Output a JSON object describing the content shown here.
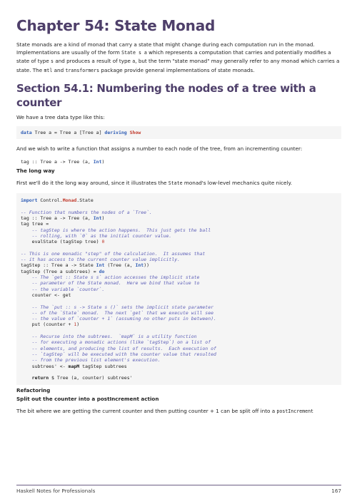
{
  "chapter_title": "Chapter 54: State Monad",
  "intro": {
    "p1": "State monads are a kind of monad that carry a state that might change during each computation run in the monad. Implementations are usually of the form ",
    "code1": "State s a",
    "p2": " which represents a computation that carries and potentially modifies a state of type ",
    "code2": "s",
    "p3": " and produces a result of type ",
    "code3": "a",
    "p4": ", but the term \"state monad\" may generally refer to any monad which carries a state. The ",
    "code4": "mtl",
    "p5": " and ",
    "code5": "transformers",
    "p6": " package provide general implementations of state monads."
  },
  "section_title": "Section 54.1: Numbering the nodes of a tree with a counter",
  "tree_intro": "We have a tree data type like this:",
  "tree_code": {
    "kw": "data",
    "body": " Tree a = Tree a [Tree a] ",
    "deriving": "deriving",
    "show": "Show"
  },
  "wish_text": "And we wish to write a function that assigns a number to each node of the tree, from an incrementing counter:",
  "tag_sig": {
    "pre": "tag :: Tree a -> Tree (a, ",
    "int": "Int",
    "post": ")"
  },
  "long_way_heading": "The long way",
  "long_way_text": {
    "pre": "First we'll do it the long way around, since it illustrates the ",
    "code": "State",
    "post": " monad's low-level mechanics quite nicely."
  },
  "code_block": {
    "import_kw": "import",
    "import_pre": " Control.",
    "import_monad": "Monad",
    "import_post": ".State",
    "lines": {
      "c1": "-- Function that numbers the nodes of a `Tree`.",
      "l2pre": "tag :: Tree a -> Tree (a, ",
      "l2int": "Int",
      "l2post": ")",
      "l3": "tag tree =",
      "c4": "    -- tagStep is where the action happens.  This just gets the ball",
      "c5": "    -- rolling, with `0` as the initial counter value.",
      "l6pre": "    evalState (tagStep tree) ",
      "l6num": "0",
      "c8": "-- This is one monadic \"step\" of the calculation.  It assumes that",
      "c9": "-- it has access to the current counter value implicitly.",
      "l10pre": "tagStep :: Tree a -> State ",
      "l10int1": "Int",
      "l10mid": " (Tree (a, ",
      "l10int2": "Int",
      "l10post": "))",
      "l11pre": "tagStep (Tree a subtrees) = ",
      "l11do": "do",
      "c12": "    -- The `get :: State s s` action accesses the implicit state",
      "c13": "    -- parameter of the State monad.  Here we bind that value to",
      "c14": "    -- the variable `counter`.",
      "l15": "    counter <- get",
      "c17": "    -- The `put :: s -> State s ()` sets the implicit state parameter",
      "c18": "    -- of the `State` monad.  The next `get` that we execute will see",
      "c19": "    -- the value of `counter + 1` (assuming no other puts in between).",
      "l20pre": "    put (counter + ",
      "l20num": "1",
      "l20post": ")",
      "c22": "    -- Recurse into the subtrees.  `mapM` is a utility function",
      "c23": "    -- for executing a monadic actions (like `tagStep`) on a list of",
      "c24": "    -- elements, and producing the list of results.  Each execution of",
      "c25": "    -- `tagStep` will be executed with the counter value that resulted",
      "c26": "    -- from the previous list element's execution.",
      "l27pre": "    subtrees' <- ",
      "l27mapm": "mapM",
      "l27post": " tagStep subtrees",
      "l29ret": "return",
      "l29post": " $ Tree (a, counter) subtrees'"
    }
  },
  "refactoring_heading": "Refactoring",
  "split_heading": "Split out the counter into a postIncrement action",
  "bottom_text": {
    "pre": "The bit where we are ",
    "get": "get",
    "mid1": "ting the current counter and then ",
    "put": "put",
    "mid2": "ting counter + 1 can be split off into a ",
    "code": "postIncrement"
  },
  "footer": {
    "left": "Haskell Notes for Professionals",
    "page": "167"
  }
}
